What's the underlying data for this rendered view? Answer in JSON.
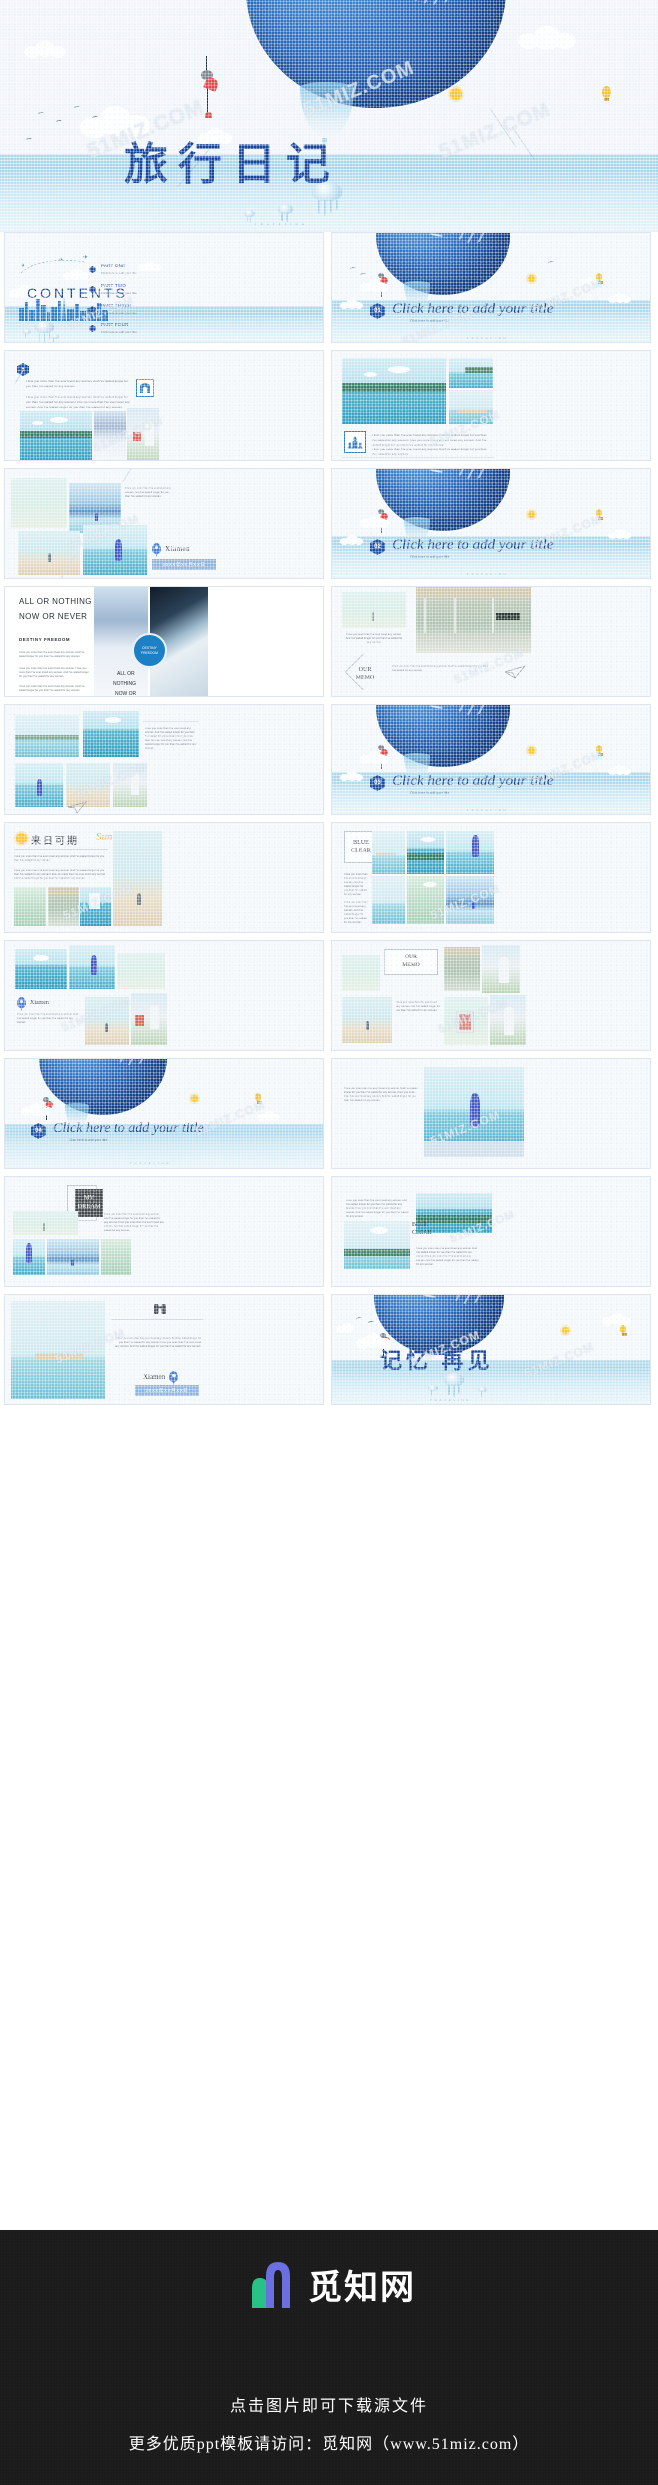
{
  "cover": {
    "title": "旅行日记",
    "watermarks": [
      "51MIZ.COM",
      "51MIZ.COM",
      "51MIZ.COM"
    ]
  },
  "slides": {
    "contents": {
      "heading": "CONTENTS",
      "items": [
        {
          "label": "PART ONE",
          "sub": "Click here to add your title"
        },
        {
          "label": "PART TWO",
          "sub": "Click here to add your title"
        },
        {
          "label": "PART THREE",
          "sub": "Click here to add your title"
        },
        {
          "label": "PART FOUR",
          "sub": "Click here to add your title"
        }
      ]
    },
    "section_01": {
      "number": "01",
      "title": "Click here to add your title",
      "subtitle": "Click here to add your title",
      "footer": "TRAVELING"
    },
    "section_02": {
      "number": "02",
      "title": "Click here to add your title",
      "subtitle": "Click here to add your title",
      "footer": "TRAVELING"
    },
    "section_03": {
      "number": "03",
      "title": "Click here to add your title",
      "subtitle": "Click here to add your title",
      "footer": "TRAVELING"
    },
    "section_04": {
      "number": "04",
      "title": "Click here to add your title",
      "subtitle": "Click here to add your title",
      "footer": "TRAVELING"
    },
    "gallery_text": {
      "body1": "I love you more than I've ever loved any woman. And I've waited longer for you than I've waited for any woman.",
      "body2": "I love you more than I've ever loved any woman. And I've waited longer for you than I've waited for any woman.I love you more than I've ever loved any woman. And I've waited longer for you than I've waited for any woman."
    },
    "island_text": {
      "body1": "I love you more than I've ever loved any woman. And I've waited longer for you than I've waited for any woman.I love you more than I've ever loved any woman. And I've waited longer for you than I've waited for any woman.",
      "body2": "I love you more than I've ever loved any woman. And I've waited longer for you than I've waited for any woman."
    },
    "xiamen": {
      "body": "I love you more than I've ever loved any woman. And I've waited longer for you than I've waited for any woman.",
      "place": "Xiamen",
      "date": "20XX年XX月XX日"
    },
    "destiny": {
      "headline_line1": "ALL OR NOTHING",
      "headline_line2": "NOW OR NEVER",
      "subhead": "DESTINY FREEDOM",
      "badge_line1": "DESTINY",
      "badge_line2": "FREEDOM",
      "stack": [
        "ALL OR",
        "NOTHING",
        "NOW OR",
        "NEVER"
      ],
      "body1": "I love you more than I've ever loved any woman. And I've waited longer for you than I've waited for any woman.",
      "body2": "I love you more than I've ever loved any woman. I love you more than I've ever loved any woman. And I've waited longer for you than I've waited for any woman.",
      "body3": "I love you more than I've ever loved any woman. And I've waited longer for you than I've waited for any woman."
    },
    "memo": {
      "title_line1": "OUR",
      "title_line2": "MEMO",
      "caption": "I love you more than I've ever loved any woman. And I've waited longer for you than I've waited for any woman.",
      "body": "I love you more than I've ever loved any woman. And I've waited longer for you than I've waited for any woman."
    },
    "gallery_notes": {
      "body": "I love you more than I've ever loved any woman. And I've waited longer for you than I've waited for any woman.I love you more than I've ever loved any woman. And I've waited longer for you than I've waited for any woman."
    },
    "sun": {
      "title": "来日可期",
      "script": "Sun",
      "body1": "I love you more than I've ever loved any woman. And I've waited longer for you than I've waited for any woman.",
      "body2": "I love you more than I've ever loved any woman. And I've waited longer for you than I've waited for any woman.I love you more than I've ever loved any woman. And I've waited longer for you than I've waited for any woman."
    },
    "blue_clear_grid": {
      "title_line1": "BLUE",
      "title_line2": "CLEAR",
      "body1": "I love you more than I've ever loved any woman. And I've waited longer for you than I've waited for any woman.",
      "body2": "I love you more than I've ever loved any woman. And I've waited longer for you than I've waited for any woman."
    },
    "my_dream": {
      "title_line1": "MY",
      "title_line2": "DREAM",
      "body": "I love you more than I've ever loved any woman. And I've waited longer for you than I've waited for any woman.I love you more than I've ever loved any woman. And I've waited longer for you than I've waited for any woman."
    },
    "blue_clear_two": {
      "title_line1": "BLUE",
      "title_line2": "CLEAR",
      "body1": "I love you more than I've ever loved any woman. And I've waited longer for you than I've waited for any woman.I love you more than I've ever loved any woman. And I've waited longer for you than I've waited for any woman.",
      "body2": "I love you more than I've ever loved any woman. And I've waited longer for you than I've waited for any woman.I love you more than I've ever loved any woman. And I've waited longer for you than I've waited for any woman."
    },
    "ending_photo": {
      "body": "I love you more than I've ever loved any woman. And I've waited longer for you than I've waited for any woman.I love you more than I've ever loved any woman. And I've waited longer for you than I've waited for any woman.",
      "place": "Xiamen",
      "date": "20XX年XX月XX日"
    },
    "ending": {
      "title": "记忆  再见",
      "footer": "TRAVELING"
    }
  },
  "footer": {
    "brand": "觅知网",
    "line1": "点击图片即可下载源文件",
    "line2": "更多优质ppt模板请访问：觅知网（www.51miz.com）"
  },
  "colors": {
    "brand_blue": "#1d4fa3",
    "accent_cyan": "#2f7dc4",
    "logo_green": "#28c286",
    "logo_purple": "#6b6fe0",
    "sea": "#9fd4e8",
    "footer_bg": "#1b1b1b"
  }
}
